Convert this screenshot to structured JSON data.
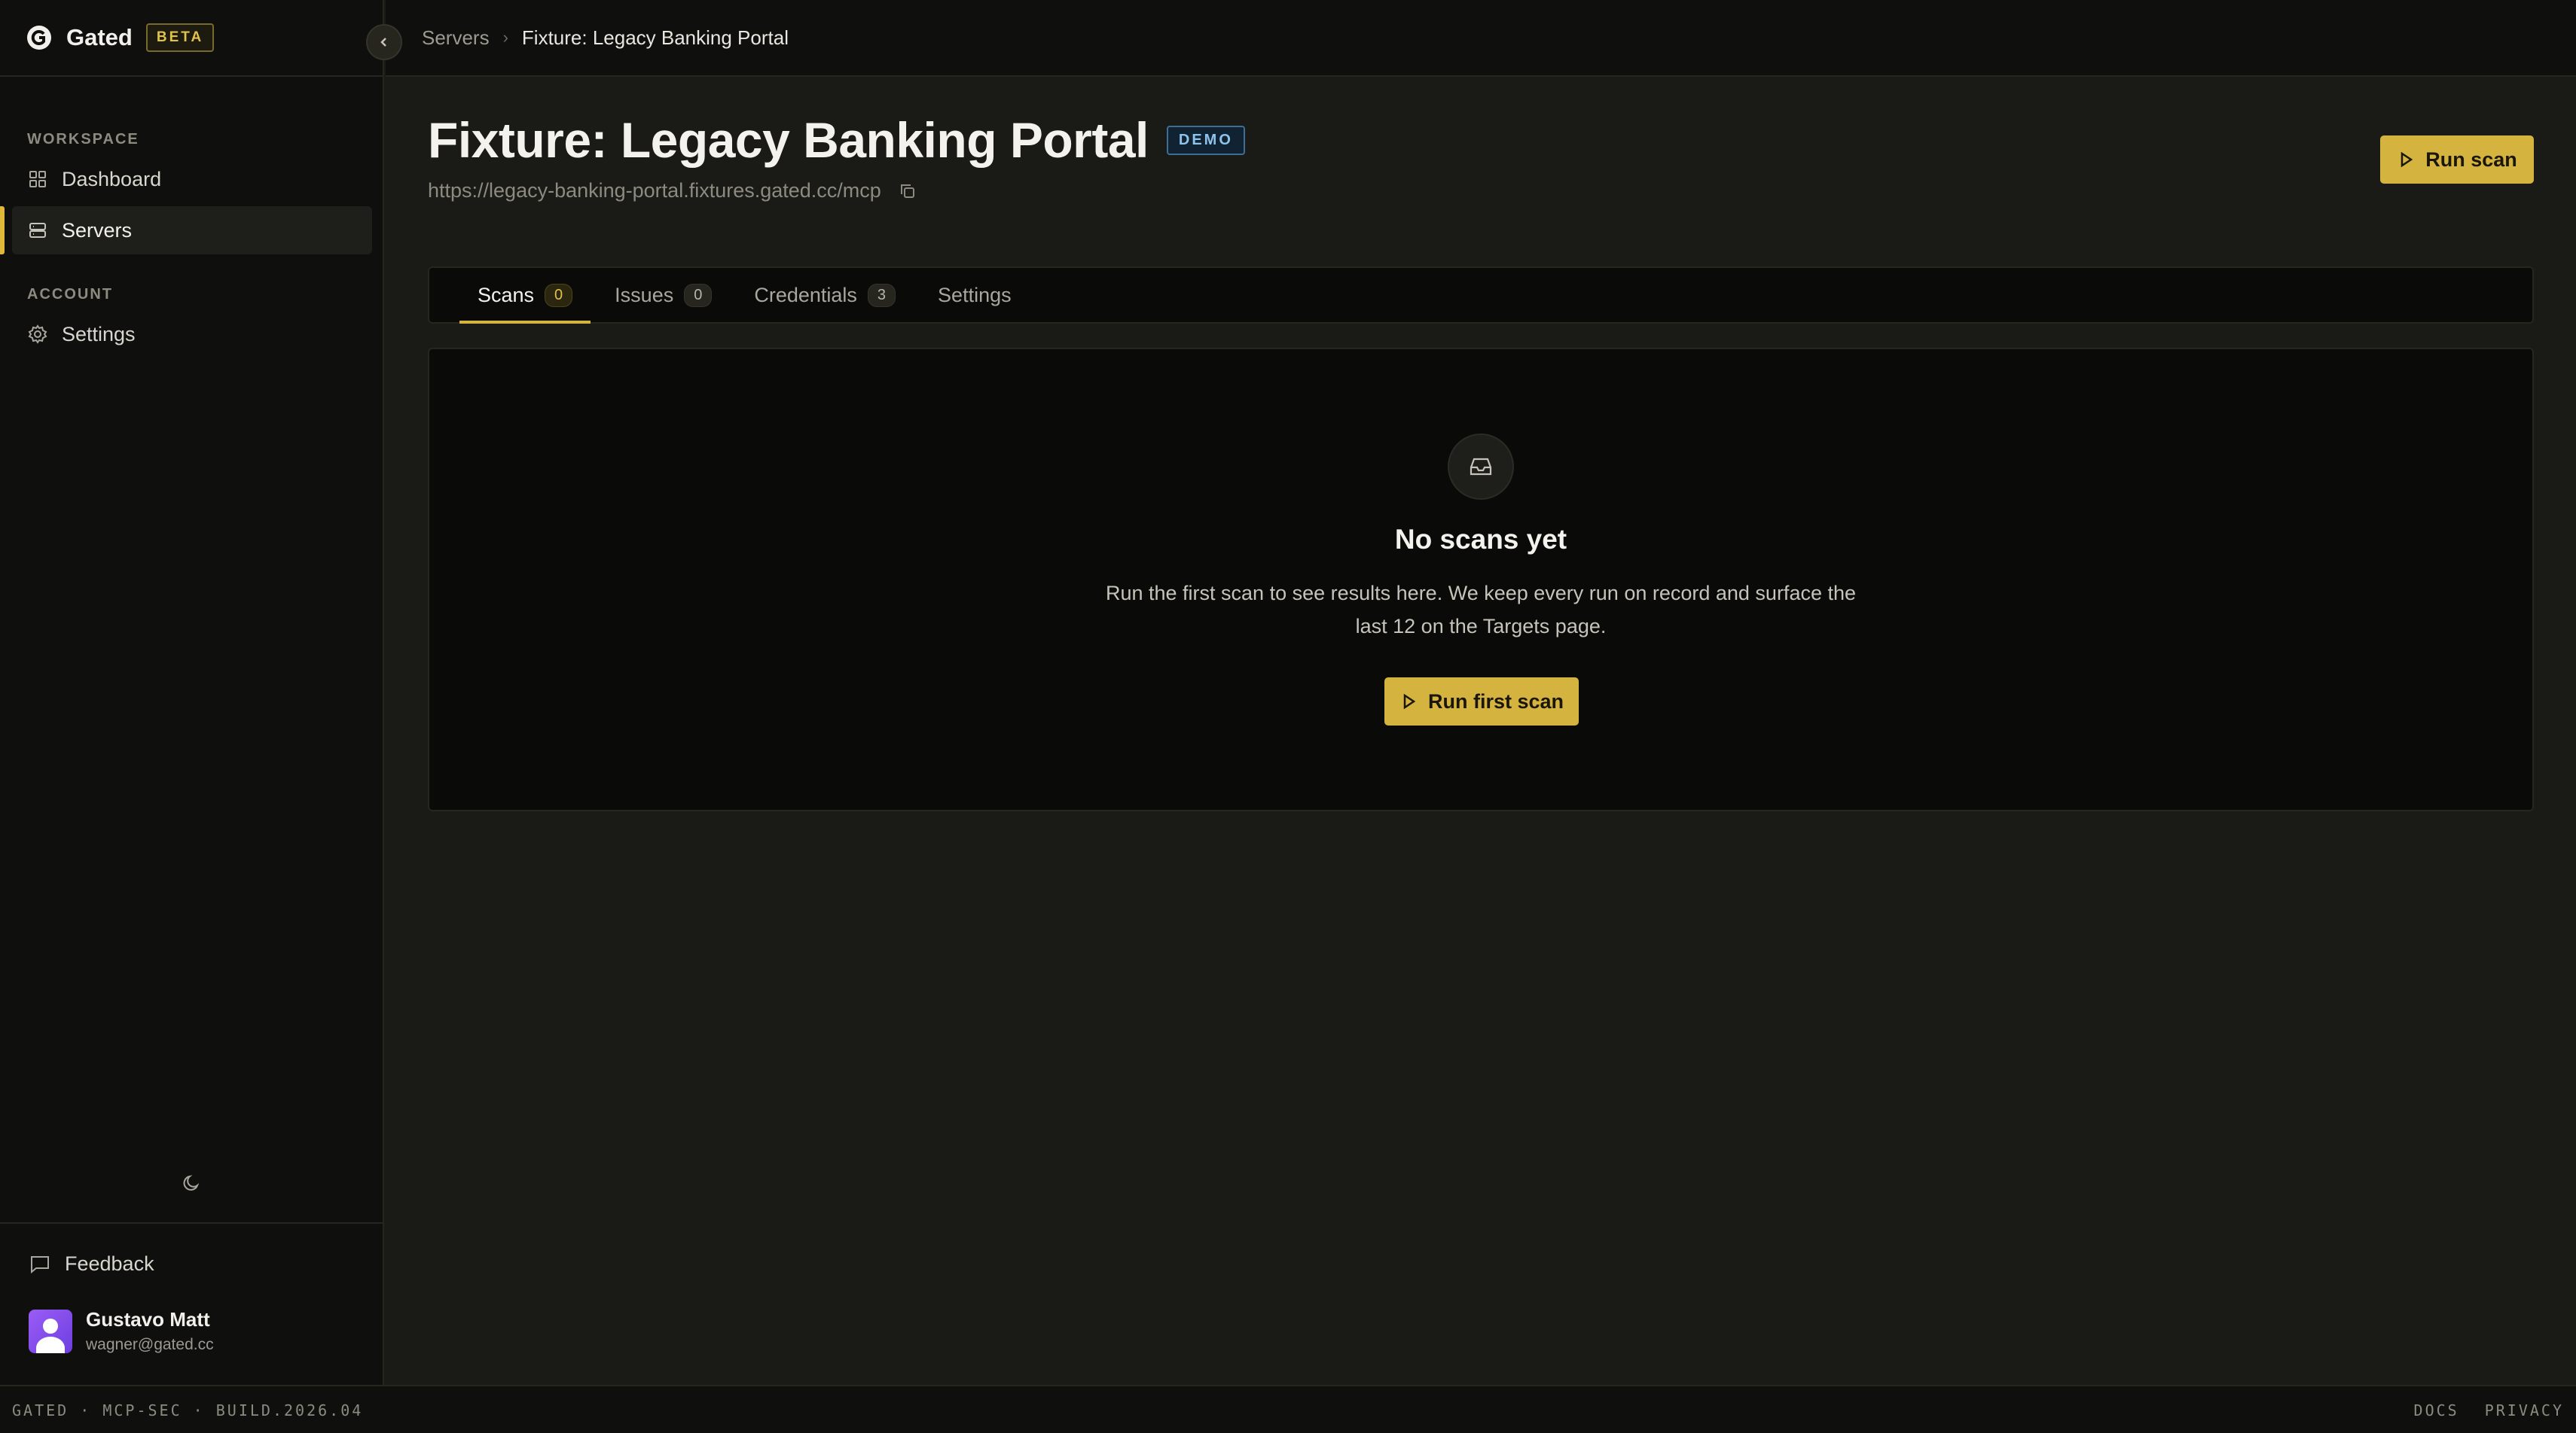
{
  "brand": {
    "name": "Gated",
    "badge": "BETA"
  },
  "sidebar": {
    "sections": [
      {
        "label": "WORKSPACE"
      },
      {
        "label": "ACCOUNT"
      }
    ],
    "items": [
      {
        "label": "Dashboard",
        "icon": "grid-icon"
      },
      {
        "label": "Servers",
        "icon": "server-icon",
        "active": true
      },
      {
        "label": "Settings",
        "icon": "gear-icon"
      }
    ],
    "feedback": "Feedback",
    "user": {
      "name": "Gustavo Matt",
      "email": "wagner@gated.cc"
    }
  },
  "breadcrumb": {
    "parent": "Servers",
    "separator": "›",
    "current": "Fixture: Legacy Banking Portal"
  },
  "page": {
    "title": "Fixture: Legacy Banking Portal",
    "badge": "DEMO",
    "url": "https://legacy-banking-portal.fixtures.gated.cc/mcp",
    "run_scan": "Run scan"
  },
  "tabs": [
    {
      "label": "Scans",
      "count": "0",
      "active": true
    },
    {
      "label": "Issues",
      "count": "0"
    },
    {
      "label": "Credentials",
      "count": "3"
    },
    {
      "label": "Settings",
      "count": ""
    }
  ],
  "empty": {
    "title": "No scans yet",
    "desc": "Run the first scan to see results here. We keep every run on record and surface the last 12 on the Targets page.",
    "button": "Run first scan"
  },
  "footer": {
    "left": "GATED · MCP-SEC · BUILD.2026.04",
    "docs": "DOCS",
    "privacy": "PRIVACY"
  },
  "colors": {
    "accent": "#d4b43f",
    "background": "#1a1a17",
    "panel": "#0a0a08",
    "demo": "#8ec3ec"
  }
}
